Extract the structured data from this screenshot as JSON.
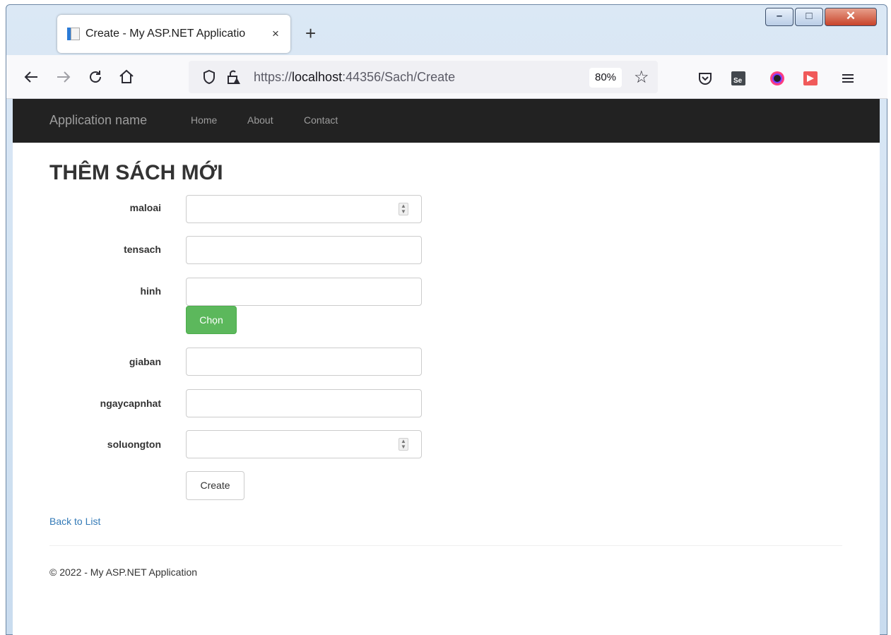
{
  "browser": {
    "tab_title": "Create - My ASP.NET Applicatio",
    "tab_close": "×",
    "new_tab": "+",
    "url_prefix": "https://",
    "url_host": "localhost",
    "url_rest": ":44356/Sach/Create",
    "zoom": "80%",
    "icons": [
      "back-arrow-icon",
      "forward-arrow-icon",
      "reload-icon",
      "home-icon",
      "shield-icon",
      "lock-warning-icon",
      "star-icon",
      "pocket-icon",
      "selenium-icon",
      "color-picker-icon",
      "extension-icon",
      "menu-icon"
    ]
  },
  "window_controls": {
    "minimize": "–",
    "maximize": "□",
    "close": "✕"
  },
  "navbar": {
    "brand": "Application name",
    "links": [
      "Home",
      "About",
      "Contact"
    ]
  },
  "page": {
    "title": "THÊM SÁCH MỚI"
  },
  "form": {
    "fields": [
      {
        "label": "maloai",
        "value": "",
        "type": "number"
      },
      {
        "label": "tensach",
        "value": "",
        "type": "text"
      },
      {
        "label": "hinh",
        "value": "",
        "type": "text"
      },
      {
        "label": "giaban",
        "value": "",
        "type": "text"
      },
      {
        "label": "ngaycapnhat",
        "value": "",
        "type": "text"
      },
      {
        "label": "soluongton",
        "value": "",
        "type": "number"
      }
    ],
    "choose_button": "Chọn",
    "submit_button": "Create"
  },
  "back_link": "Back to List",
  "footer": "© 2022 - My ASP.NET Application",
  "colors": {
    "navbar_bg": "#222222",
    "success": "#5cb85c",
    "link": "#337ab7"
  }
}
